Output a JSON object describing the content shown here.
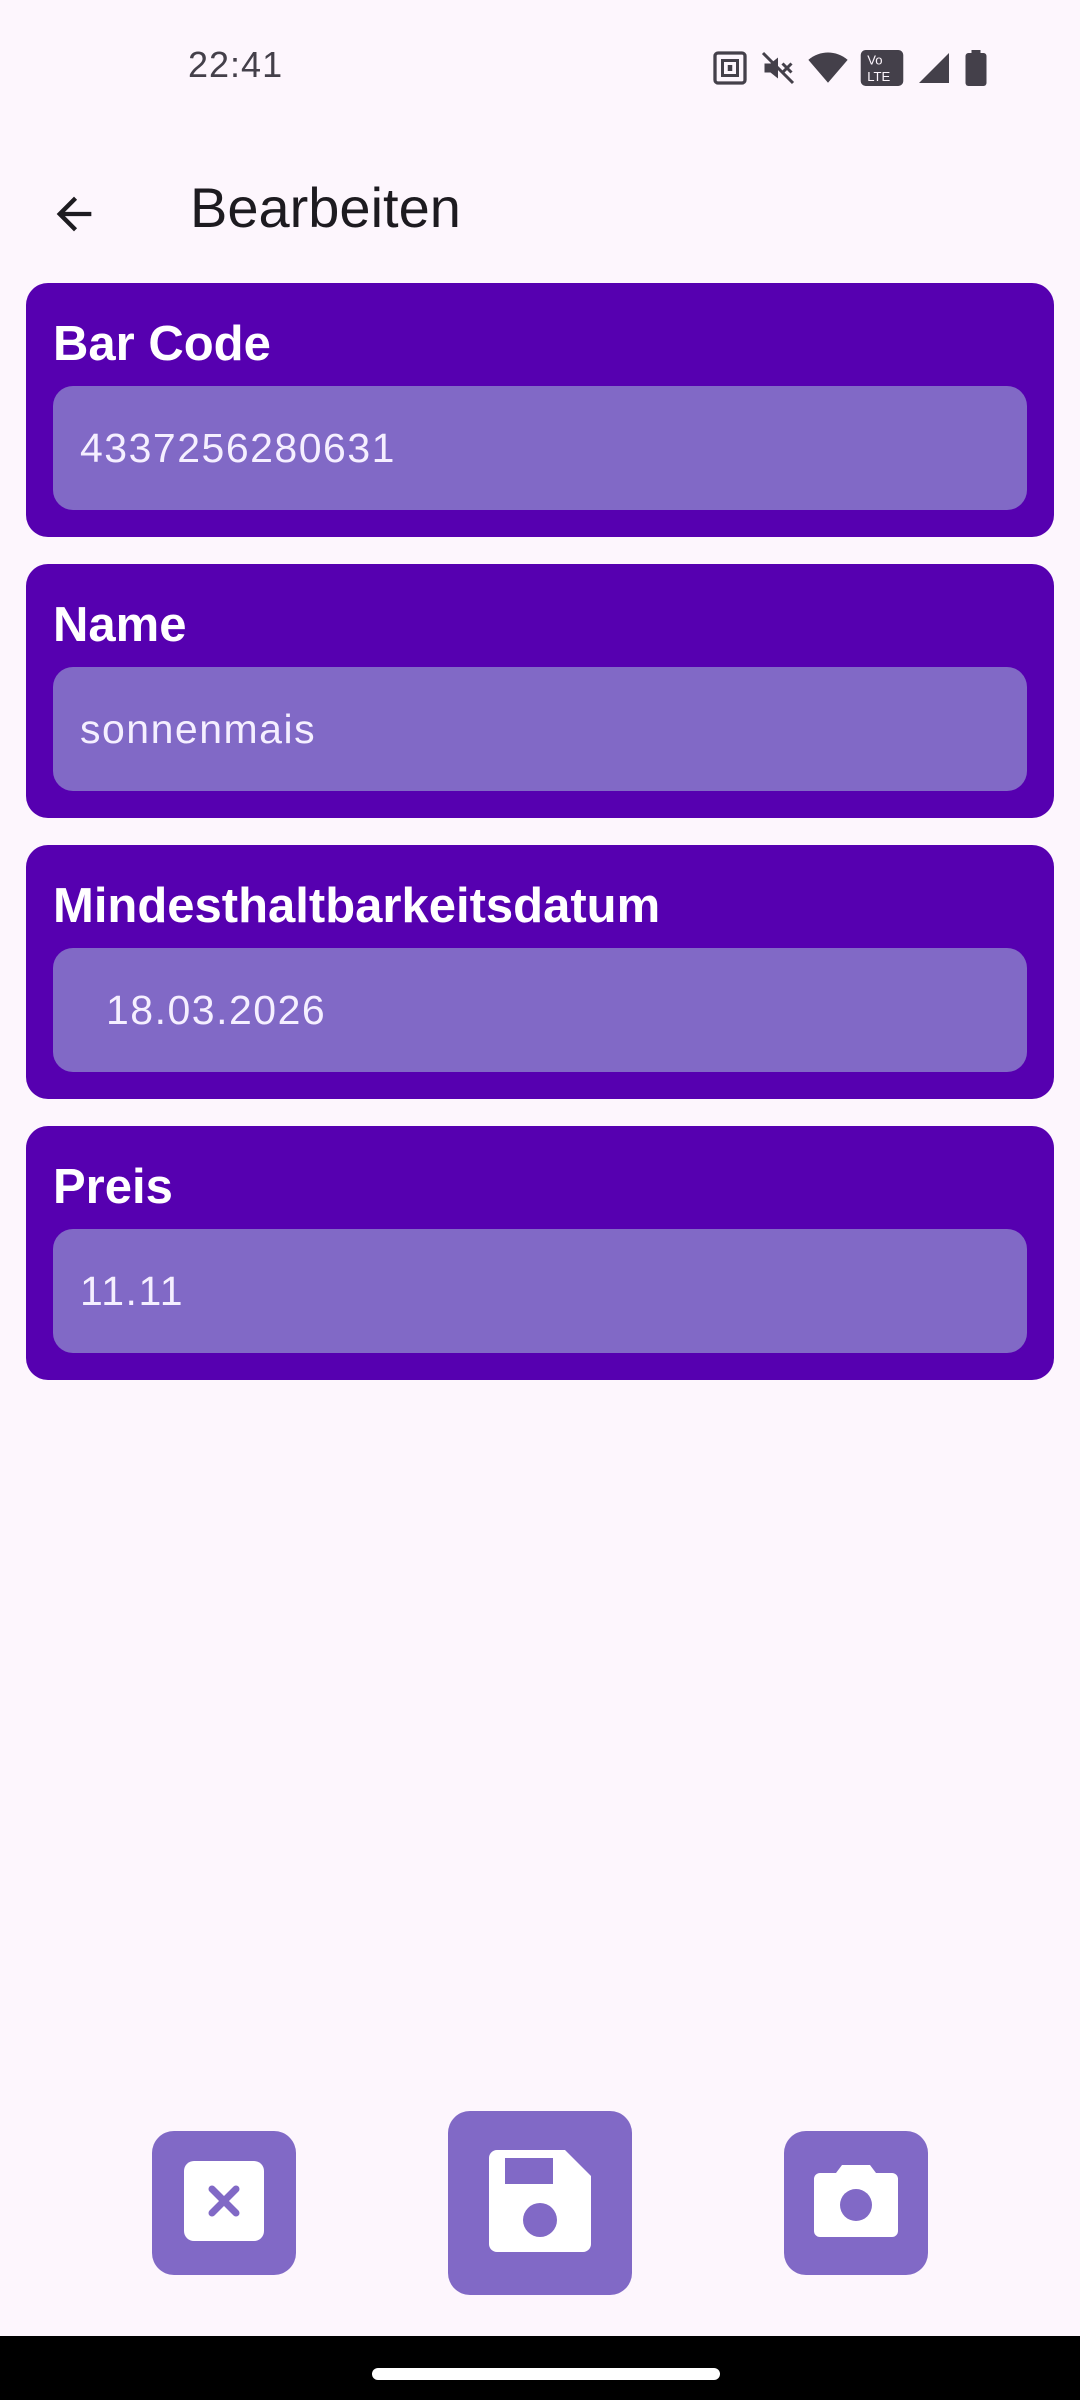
{
  "status_bar": {
    "time": "22:41",
    "icons": [
      "nfc-icon",
      "mute-icon",
      "wifi-icon",
      "volte-icon",
      "signal-icon",
      "battery-icon"
    ],
    "volte_text": "Vo LTE"
  },
  "app_bar": {
    "back_icon": "arrow-back-icon",
    "title": "Bearbeiten"
  },
  "form": {
    "barcode": {
      "label": "Bar Code",
      "value": "4337256280631"
    },
    "name": {
      "label": "Name",
      "value": "sonnenmais"
    },
    "best_before": {
      "label": "Mindesthaltbarkeitsdatum",
      "value": "18.03.2026"
    },
    "price": {
      "label": "Preis",
      "value": "11.11"
    }
  },
  "actions": {
    "cancel_icon": "close-box-icon",
    "save_icon": "floppy-disk-icon",
    "camera_icon": "camera-icon"
  },
  "colors": {
    "background": "#fdf6fd",
    "card": "#5600b0",
    "field": "#8169c6",
    "text_on_card": "#ffffff",
    "title": "#1d1b20"
  }
}
